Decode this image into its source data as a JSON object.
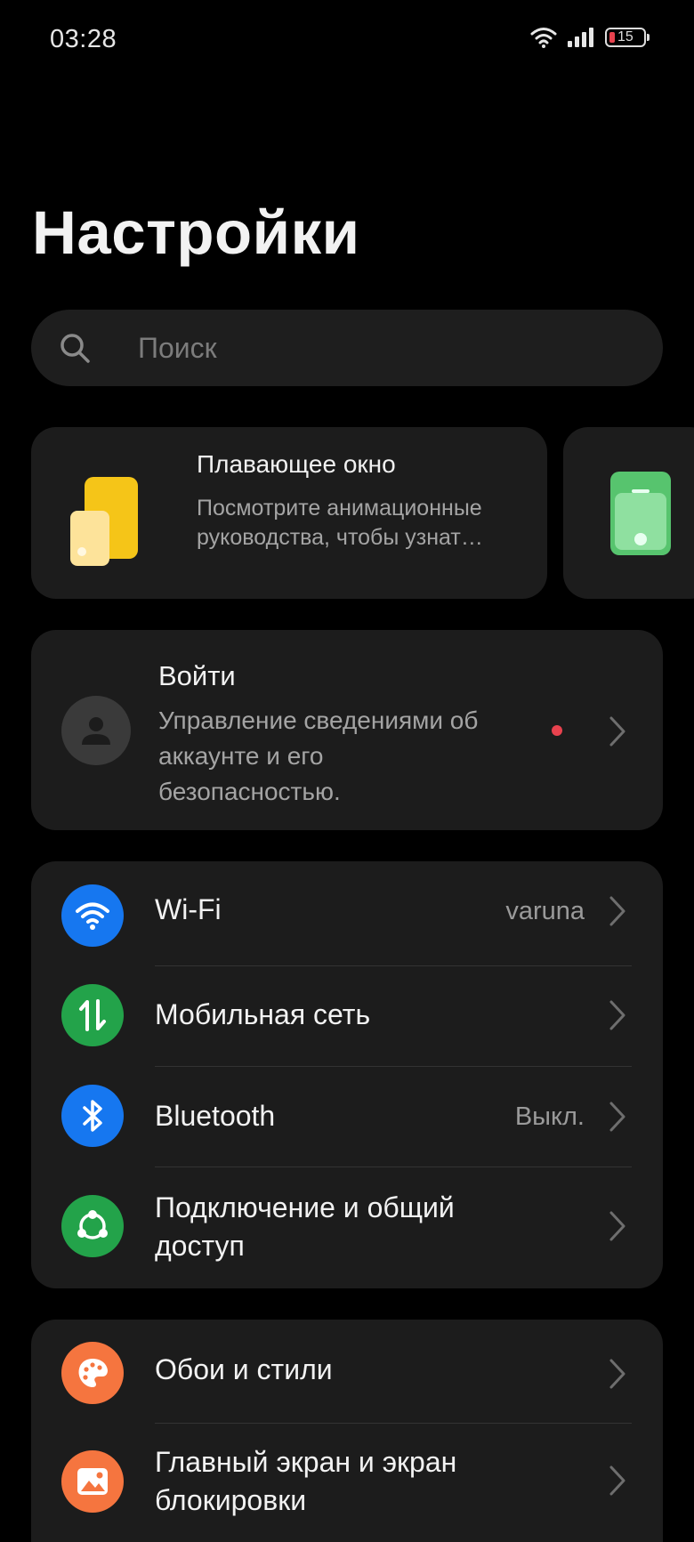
{
  "status_bar": {
    "time": "03:28",
    "battery_level": "15",
    "icons": [
      "wifi-icon",
      "signal-icon",
      "battery-icon"
    ]
  },
  "page": {
    "title": "Настройки"
  },
  "search": {
    "placeholder": "Поиск"
  },
  "promo": {
    "title": "Плавающее окно",
    "description": "Посмотрите анимационные руководства, чтобы узнат…"
  },
  "account": {
    "title": "Войти",
    "description": "Управление сведениями об аккаунте и его безопасностью."
  },
  "connectivity_group": {
    "items": [
      {
        "label": "Wi-Fi",
        "value": "varuna",
        "icon": "wifi-icon",
        "color": "#1677f0"
      },
      {
        "label": "Мобильная сеть",
        "value": "",
        "icon": "mobile-data-icon",
        "color": "#23a34a"
      },
      {
        "label": "Bluetooth",
        "value": "Выкл.",
        "icon": "bluetooth-icon",
        "color": "#1677f0"
      },
      {
        "label": "Подключение и общий доступ",
        "value": "",
        "icon": "share-icon",
        "color": "#23a34a"
      }
    ]
  },
  "personalization_group": {
    "items": [
      {
        "label": "Обои и стили",
        "value": "",
        "icon": "palette-icon",
        "color": "#f5753f"
      },
      {
        "label": "Главный экран и экран блокировки",
        "value": "",
        "icon": "image-icon",
        "color": "#f5753f"
      }
    ]
  },
  "colors": {
    "background": "#000000",
    "card": "#1c1c1c",
    "accent_blue": "#1677f0",
    "accent_green": "#23a34a",
    "accent_orange": "#f5753f",
    "notify_red": "#e8424e"
  }
}
